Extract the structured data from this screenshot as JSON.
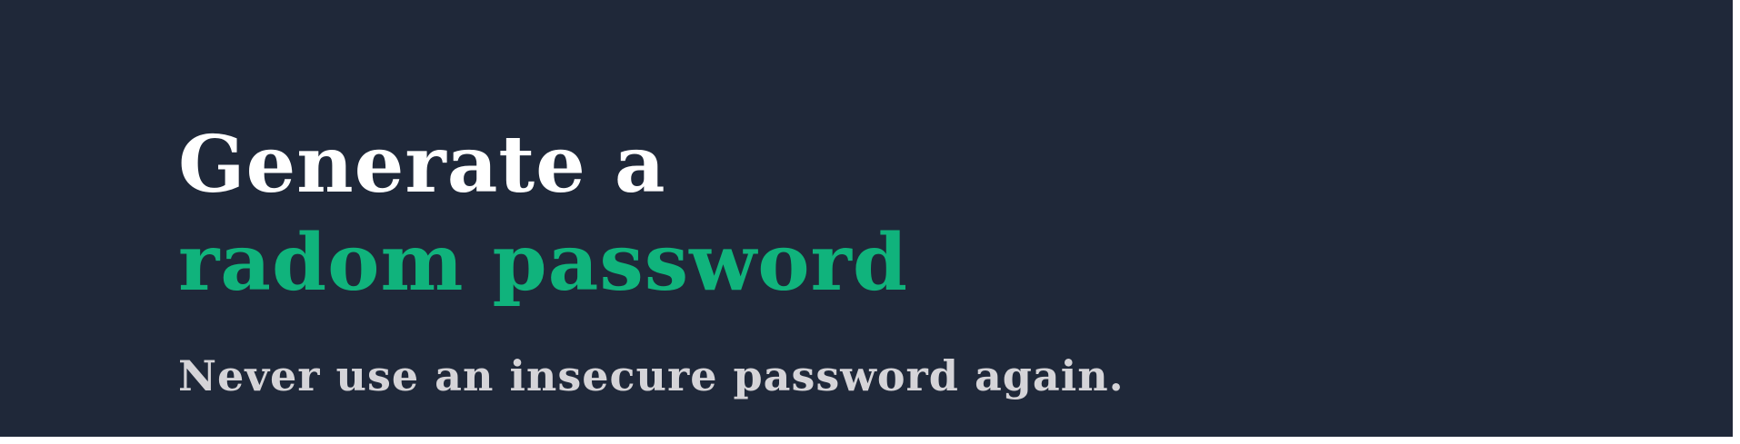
{
  "hero": {
    "title_line_1": "Generate a",
    "title_line_2": "radom password",
    "tagline": "Never use an insecure password again."
  },
  "colors": {
    "background": "#1f2839",
    "title": "#ffffff",
    "accent": "#10b37c",
    "tagline": "#d5d4d8"
  }
}
